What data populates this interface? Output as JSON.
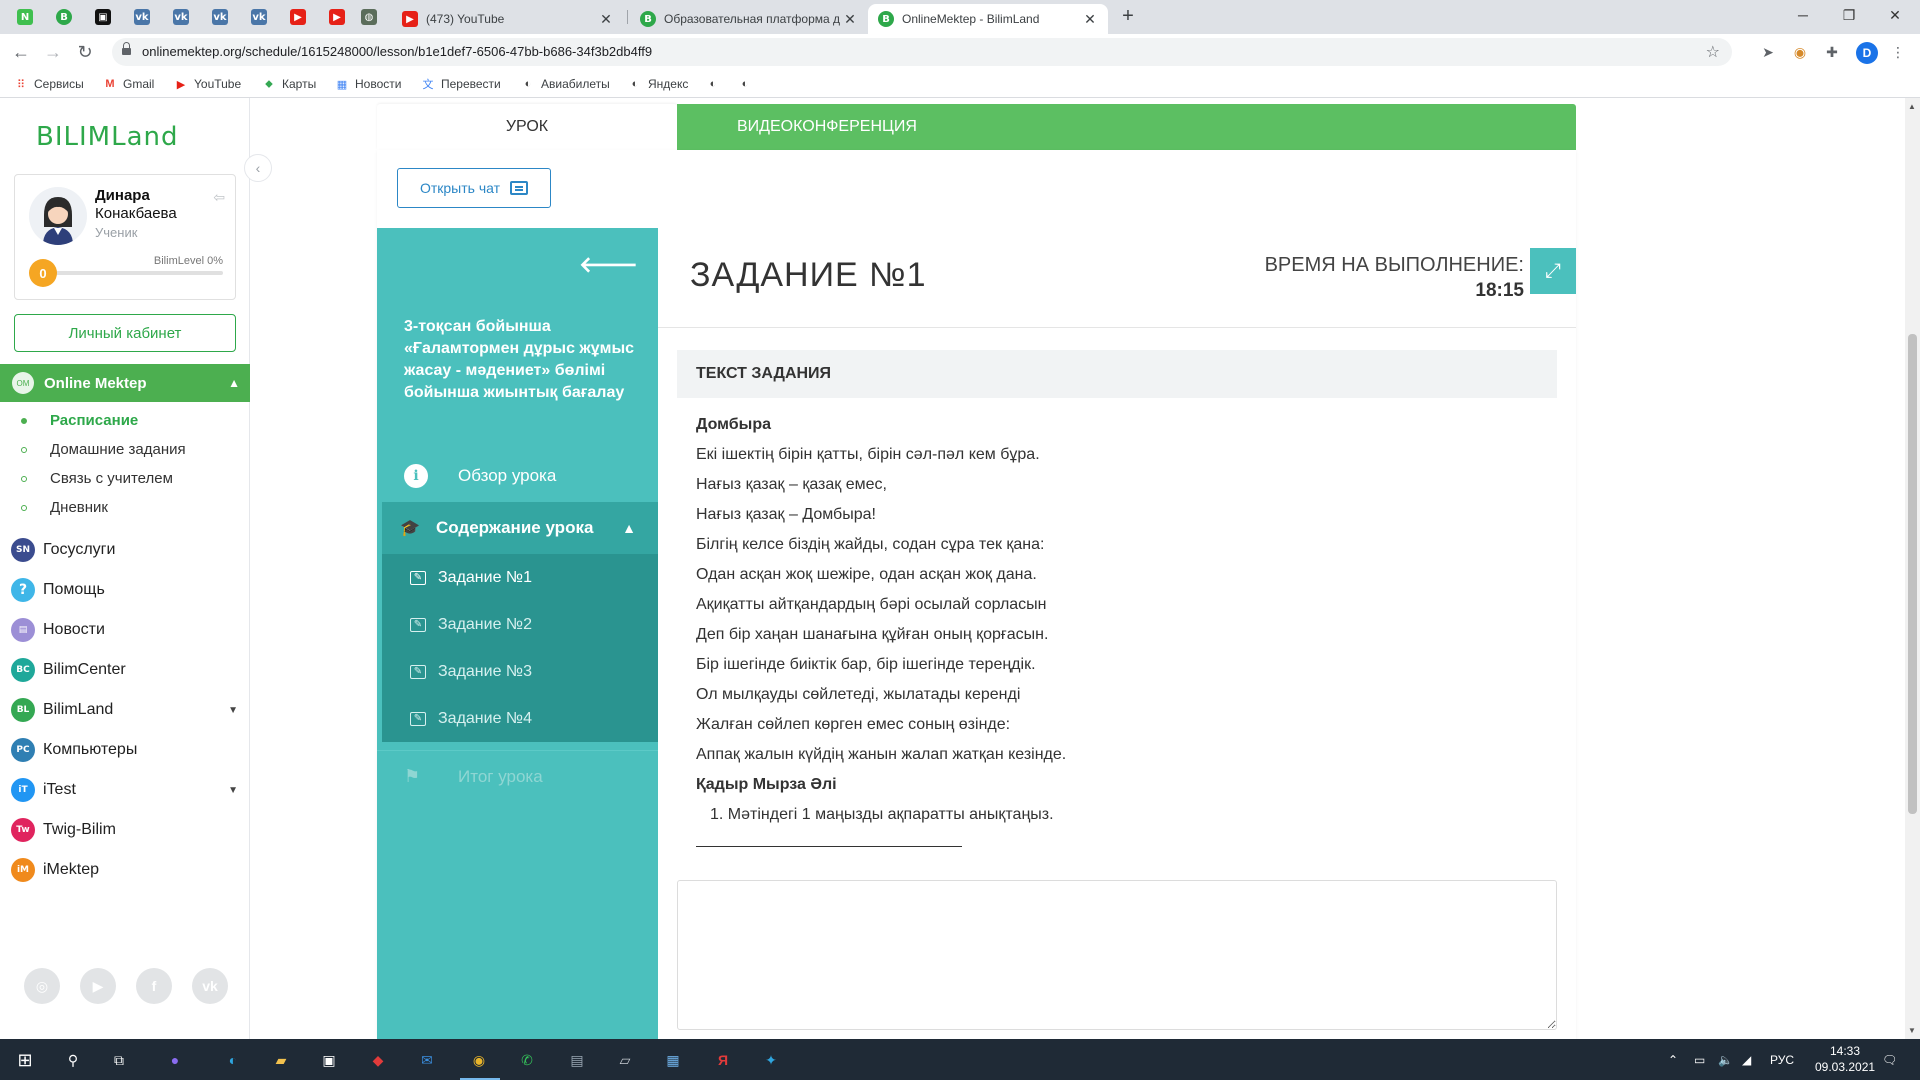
{
  "browser": {
    "tabs": [
      {
        "title": "(473) YouTube",
        "icon": "youtube-icon"
      },
      {
        "title": "Образовательная платформа д",
        "icon": "bilimland-icon"
      },
      {
        "title": "OnlineMektep - BilimLand",
        "icon": "bilimland-icon",
        "active": true
      }
    ],
    "url": "onlinemektep.org/schedule/1615248000/lesson/b1e1def7-6506-47bb-b686-34f3b2db4ff9",
    "profile_initial": "D",
    "bookmarks": [
      {
        "label": "Сервисы",
        "icon": "apps-grid-icon"
      },
      {
        "label": "Gmail",
        "icon": "gmail-icon"
      },
      {
        "label": "YouTube",
        "icon": "youtube-icon"
      },
      {
        "label": "Карты",
        "icon": "maps-pin-icon"
      },
      {
        "label": "Новости",
        "icon": "news-icon"
      },
      {
        "label": "Перевести",
        "icon": "translate-icon"
      },
      {
        "label": "Авиабилеты",
        "icon": "globe-icon"
      },
      {
        "label": "Яндекс",
        "icon": "globe-icon"
      }
    ]
  },
  "sidebar": {
    "logo": "BILIMLand",
    "profile": {
      "first_name": "Динара",
      "last_name": "Конакбаева",
      "role": "Ученик",
      "level": "0",
      "level_label": "BilimLevel 0%",
      "level_progress": 0
    },
    "cabinet_button": "Личный кабинет",
    "active_section": "Online Mektep",
    "submenu": [
      {
        "label": "Расписание",
        "active": true
      },
      {
        "label": "Домашние задания"
      },
      {
        "label": "Связь с учителем"
      },
      {
        "label": "Дневник"
      }
    ],
    "menu": [
      {
        "label": "Госуслуги",
        "icon": "smart-nation-icon",
        "color": "#3b4c8f"
      },
      {
        "label": "Помощь",
        "icon": "question-icon",
        "color": "#3fb6e8"
      },
      {
        "label": "Новости",
        "icon": "news-icon",
        "color": "#9c8fd6"
      },
      {
        "label": "BilimCenter",
        "icon": "bilimcenter-icon",
        "color": "#1fa89a"
      },
      {
        "label": "BilimLand",
        "icon": "bilimland-icon",
        "color": "#34a853",
        "expandable": true
      },
      {
        "label": "Компьютеры",
        "icon": "computers-icon",
        "color": "#2f7fb3"
      },
      {
        "label": "iTest",
        "icon": "itest-icon",
        "color": "#2196f3",
        "expandable": true
      },
      {
        "label": "Twig-Bilim",
        "icon": "twig-icon",
        "color": "#e0245e"
      },
      {
        "label": "iMektep",
        "icon": "imektep-icon",
        "color": "#f08a1c"
      }
    ]
  },
  "lesson": {
    "tab_lesson": "УРОК",
    "tab_video": "ВИДЕОКОНФЕРЕНЦИЯ",
    "chat_button": "Открыть чат",
    "title": "3-тоқсан бойынша «Ғаламтормен дұрыс жұмыс жасау - мәдениет» бөлімі бойынша жиынтық бағалау",
    "overview": "Обзор урока",
    "content": "Содержание урока",
    "tasks": [
      "Задание №1",
      "Задание №2",
      "Задание №3",
      "Задание №4"
    ],
    "final": "Итог урока"
  },
  "task": {
    "title": "ЗАДАНИЕ №1",
    "time_label": "ВРЕМЯ НА ВЫПОЛНЕНИЕ:",
    "time_value": "18:15",
    "text_header": "ТЕКСТ ЗАДАНИЯ",
    "poem_title": "Домбыра",
    "poem_lines": [
      "Екі ішектің бірін қатты, бірін сәл-пәл кем бұра.",
      "Нағыз қазақ – қазақ емес,",
      "Нағыз қазақ – Домбыра!",
      "Білгің келсе біздің жайды, содан сұра тек қана:",
      "Одан асқан жоқ шежіре, одан асқан жоқ дана.",
      "Ақиқатты айтқандардың бәрі осылай сорласын",
      "Деп бір хаңан шанағына құйған оның қорғасын.",
      "Бір ішегінде биіктік бар, бір ішегінде тереңдік.",
      "Ол мылқауды сөйлетеді, жылатады керенді",
      "Жалған сөйлеп көрген емес соның өзінде:",
      "Аппақ жалын күйдің жанын жалап жатқан кезінде."
    ],
    "author": "Қадыр Мырза Әлі",
    "question": "1. Мәтіндегі 1 маңызды ақпаратты анықтаңыз."
  },
  "taskbar": {
    "language": "РУС",
    "time": "14:33",
    "date": "09.03.2021"
  }
}
